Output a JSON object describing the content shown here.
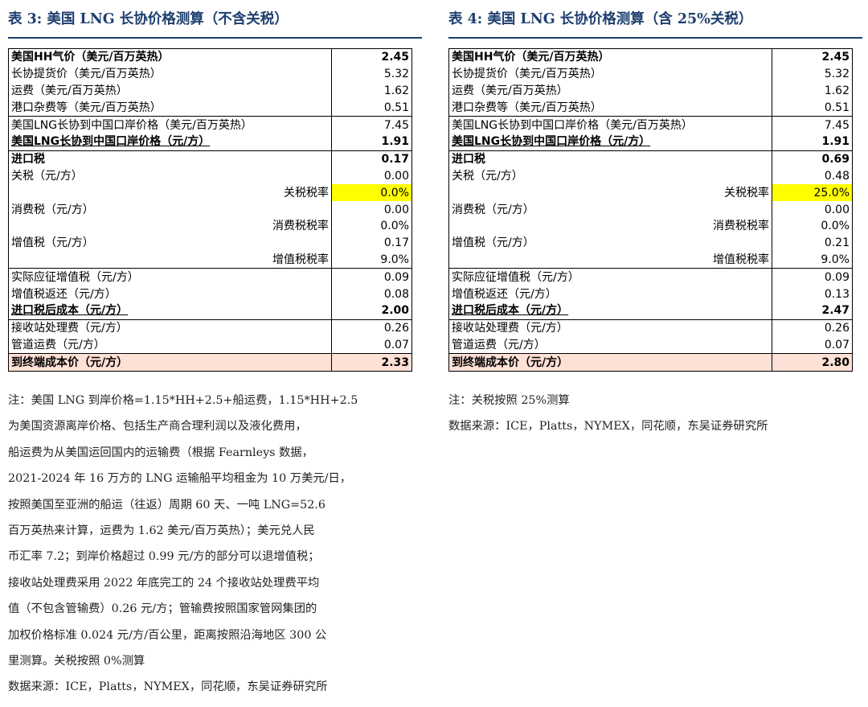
{
  "left": {
    "title": "表 3:  美国 LNG 长协价格测算（不含关税）",
    "rows": [
      {
        "label": "美国HH气价（美元/百万英热）",
        "value": "2.45"
      },
      {
        "label": "长协提货价（美元/百万英热）",
        "value": "5.32"
      },
      {
        "label": "运费（美元/百万英热）",
        "value": "1.62"
      },
      {
        "label": "港口杂费等（美元/百万英热）",
        "value": "0.51"
      },
      {
        "label": "美国LNG长协到中国口岸价格（美元/百万英热）",
        "value": "7.45"
      },
      {
        "label": "美国LNG长协到中国口岸价格（元/方）",
        "value": "1.91"
      },
      {
        "label": "进口税",
        "value": "0.17"
      },
      {
        "label": "关税（元/方）",
        "value": "0.00"
      },
      {
        "label": "关税税率",
        "value": "0.0%"
      },
      {
        "label": "消费税（元/方）",
        "value": "0.00"
      },
      {
        "label": "消费税税率",
        "value": "0.0%"
      },
      {
        "label": "增值税（元/方）",
        "value": "0.17"
      },
      {
        "label": "增值税税率",
        "value": "9.0%"
      },
      {
        "label": "实际应征增值税（元/方）",
        "value": "0.09"
      },
      {
        "label": "增值税返还（元/方）",
        "value": "0.08"
      },
      {
        "label": "进口税后成本（元/方）",
        "value": "2.00"
      },
      {
        "label": "接收站处理费（元/方）",
        "value": "0.26"
      },
      {
        "label": "管道运费（元/方）",
        "value": "0.07"
      },
      {
        "label": "到终端成本价（元/方）",
        "value": "2.33"
      }
    ],
    "notes": [
      "注：美国 LNG  到岸价格=1.15*HH+2.5+船运费，1.15*HH+2.5",
      "为美国资源离岸价格、包括生产商合理利润以及液化费用，",
      "船运费为从美国运回国内的运输费（根据 Fearnleys 数据，",
      "2021-2024 年 16 万方的 LNG 运输船平均租金为 10 万美元/日，",
      "按照美国至亚洲的船运（往返）周期 60 天、一吨 LNG=52.6",
      "百万英热来计算，运费为 1.62 美元/百万英热）；美元兑人民",
      "币汇率 7.2；到岸价格超过 0.99 元/方的部分可以退增值税；",
      "接收站处理费采用 2022 年底完工的 24 个接收站处理费平均",
      "值（不包含管输费）0.26 元/方；管输费按照国家管网集团的",
      "加权价格标准 0.024 元/方/百公里，距离按照沿海地区 300 公",
      "里测算。关税按照 0%测算",
      "数据来源：ICE，Platts，NYMEX，同花顺，东吴证券研究所"
    ]
  },
  "right": {
    "title": "表 4:  美国 LNG 长协价格测算（含 25%关税）",
    "rows": [
      {
        "label": "美国HH气价（美元/百万英热）",
        "value": "2.45"
      },
      {
        "label": "长协提货价（美元/百万英热）",
        "value": "5.32"
      },
      {
        "label": "运费（美元/百万英热）",
        "value": "1.62"
      },
      {
        "label": "港口杂费等（美元/百万英热）",
        "value": "0.51"
      },
      {
        "label": "美国LNG长协到中国口岸价格（美元/百万英热）",
        "value": "7.45"
      },
      {
        "label": "美国LNG长协到中国口岸价格（元/方）",
        "value": "1.91"
      },
      {
        "label": "进口税",
        "value": "0.69"
      },
      {
        "label": "关税（元/方）",
        "value": "0.48"
      },
      {
        "label": "关税税率",
        "value": "25.0%"
      },
      {
        "label": "消费税（元/方）",
        "value": "0.00"
      },
      {
        "label": "消费税税率",
        "value": "0.0%"
      },
      {
        "label": "增值税（元/方）",
        "value": "0.21"
      },
      {
        "label": "增值税税率",
        "value": "9.0%"
      },
      {
        "label": "实际应征增值税（元/方）",
        "value": "0.09"
      },
      {
        "label": "增值税返还（元/方）",
        "value": "0.13"
      },
      {
        "label": "进口税后成本（元/方）",
        "value": "2.47"
      },
      {
        "label": "接收站处理费（元/方）",
        "value": "0.26"
      },
      {
        "label": "管道运费（元/方）",
        "value": "0.07"
      },
      {
        "label": "到终端成本价（元/方）",
        "value": "2.80"
      }
    ],
    "notes": [
      "注：关税按照 25%测算",
      "数据来源：ICE，Platts，NYMEX，同花顺，东吴证券研究所"
    ]
  },
  "colors": {
    "title": "#1e3f6f",
    "highlight_rate": "#ffff00",
    "highlight_total": "#fde0d6"
  }
}
